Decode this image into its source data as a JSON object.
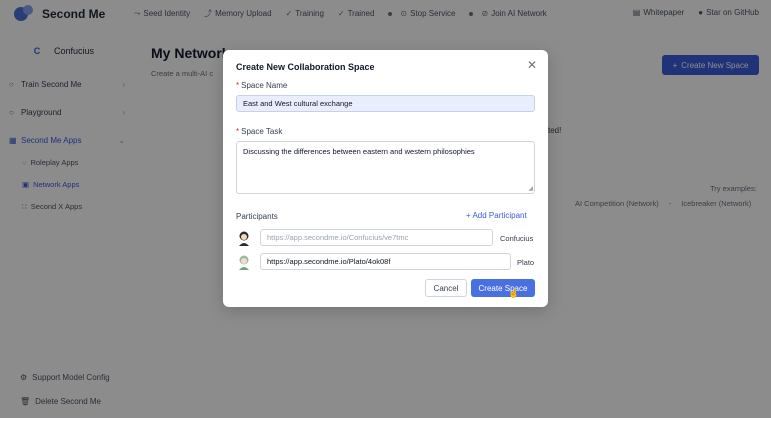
{
  "app": {
    "logo_text": "Second Me"
  },
  "topbar": {
    "steps": [
      {
        "label": "Seed Identity",
        "icon": "seed-icon"
      },
      {
        "label": "Memory Upload",
        "icon": "upload-icon"
      },
      {
        "label": "Training",
        "icon": "training-icon"
      },
      {
        "label": "Trained",
        "icon": "check-icon"
      }
    ],
    "stop_service": "Stop Service",
    "join_network": "Join AI Network",
    "whitepaper": "Whitepaper",
    "github": "Star on GitHub"
  },
  "sidebar": {
    "user_initial": "C",
    "user_name": "Confucius",
    "items": [
      {
        "label": "Train Second Me"
      },
      {
        "label": "Playground"
      },
      {
        "label": "Second Me Apps"
      }
    ],
    "sub_items": [
      {
        "label": "Roleplay Apps"
      },
      {
        "label": "Network Apps"
      },
      {
        "label": "Second X Apps"
      }
    ],
    "support": "Support Model Config",
    "delete": "Delete Second Me"
  },
  "main": {
    "title": "My Network",
    "subtitle": "Create a multi-AI c",
    "create_button": "Create New Space",
    "partial_text": "ted!",
    "try_examples": "Try examples:",
    "examples": [
      "AI Competition (Network)",
      "-",
      "Icebreaker (Network)"
    ]
  },
  "modal": {
    "title": "Create New Collaboration Space",
    "space_name_label": "Space Name",
    "space_name_value": "East and West cultural exchange",
    "space_task_label": "Space Task",
    "space_task_value": "Discussing the differences between eastern and western philosophies",
    "participants_label": "Participants",
    "add_participant": "+ Add Participant",
    "participants": [
      {
        "placeholder": "https://app.secondme.io/Confucius/ve7tmc",
        "value": "",
        "name": "Confucius"
      },
      {
        "placeholder": "",
        "value": "https://app.secondme.io/Plato/4ok08f",
        "name": "Plato"
      }
    ],
    "cancel": "Cancel",
    "create": "Create Space"
  },
  "colors": {
    "accent": "#3b5bdb",
    "required": "#dc2626"
  }
}
